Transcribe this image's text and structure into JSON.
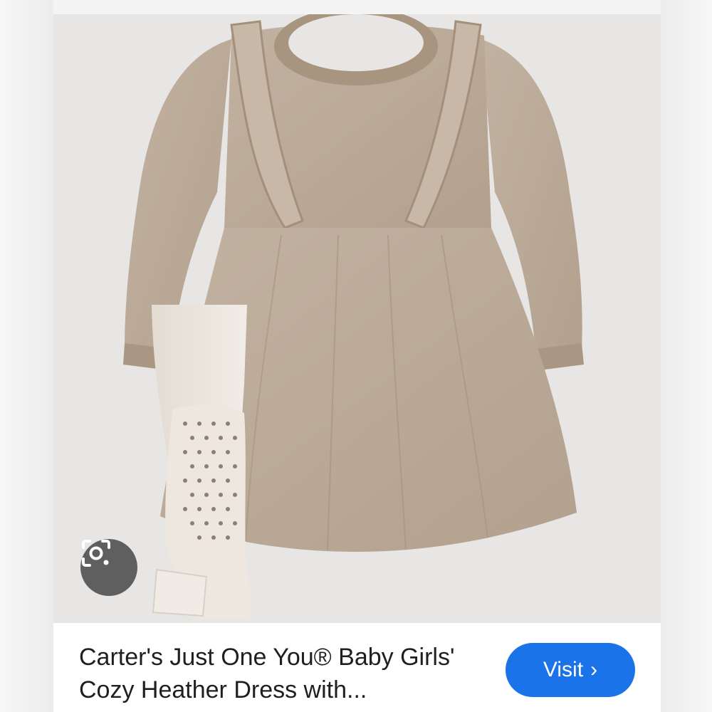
{
  "result": {
    "title": "Carter's Just One You® Baby Girls' Cozy Heather Dress with...",
    "visit_label": "Visit",
    "visit_icon": "chevron-right-icon",
    "lens_icon": "google-lens-camera-icon",
    "image_subject": "beige knit ruffle dress with cream polka-dot tights",
    "colors": {
      "accent": "#1a73e8",
      "dress": "#b9a896",
      "tights": "#ece6df",
      "photo_bg": "#e7e6e4",
      "lens_button": "#5f5f5f"
    }
  }
}
